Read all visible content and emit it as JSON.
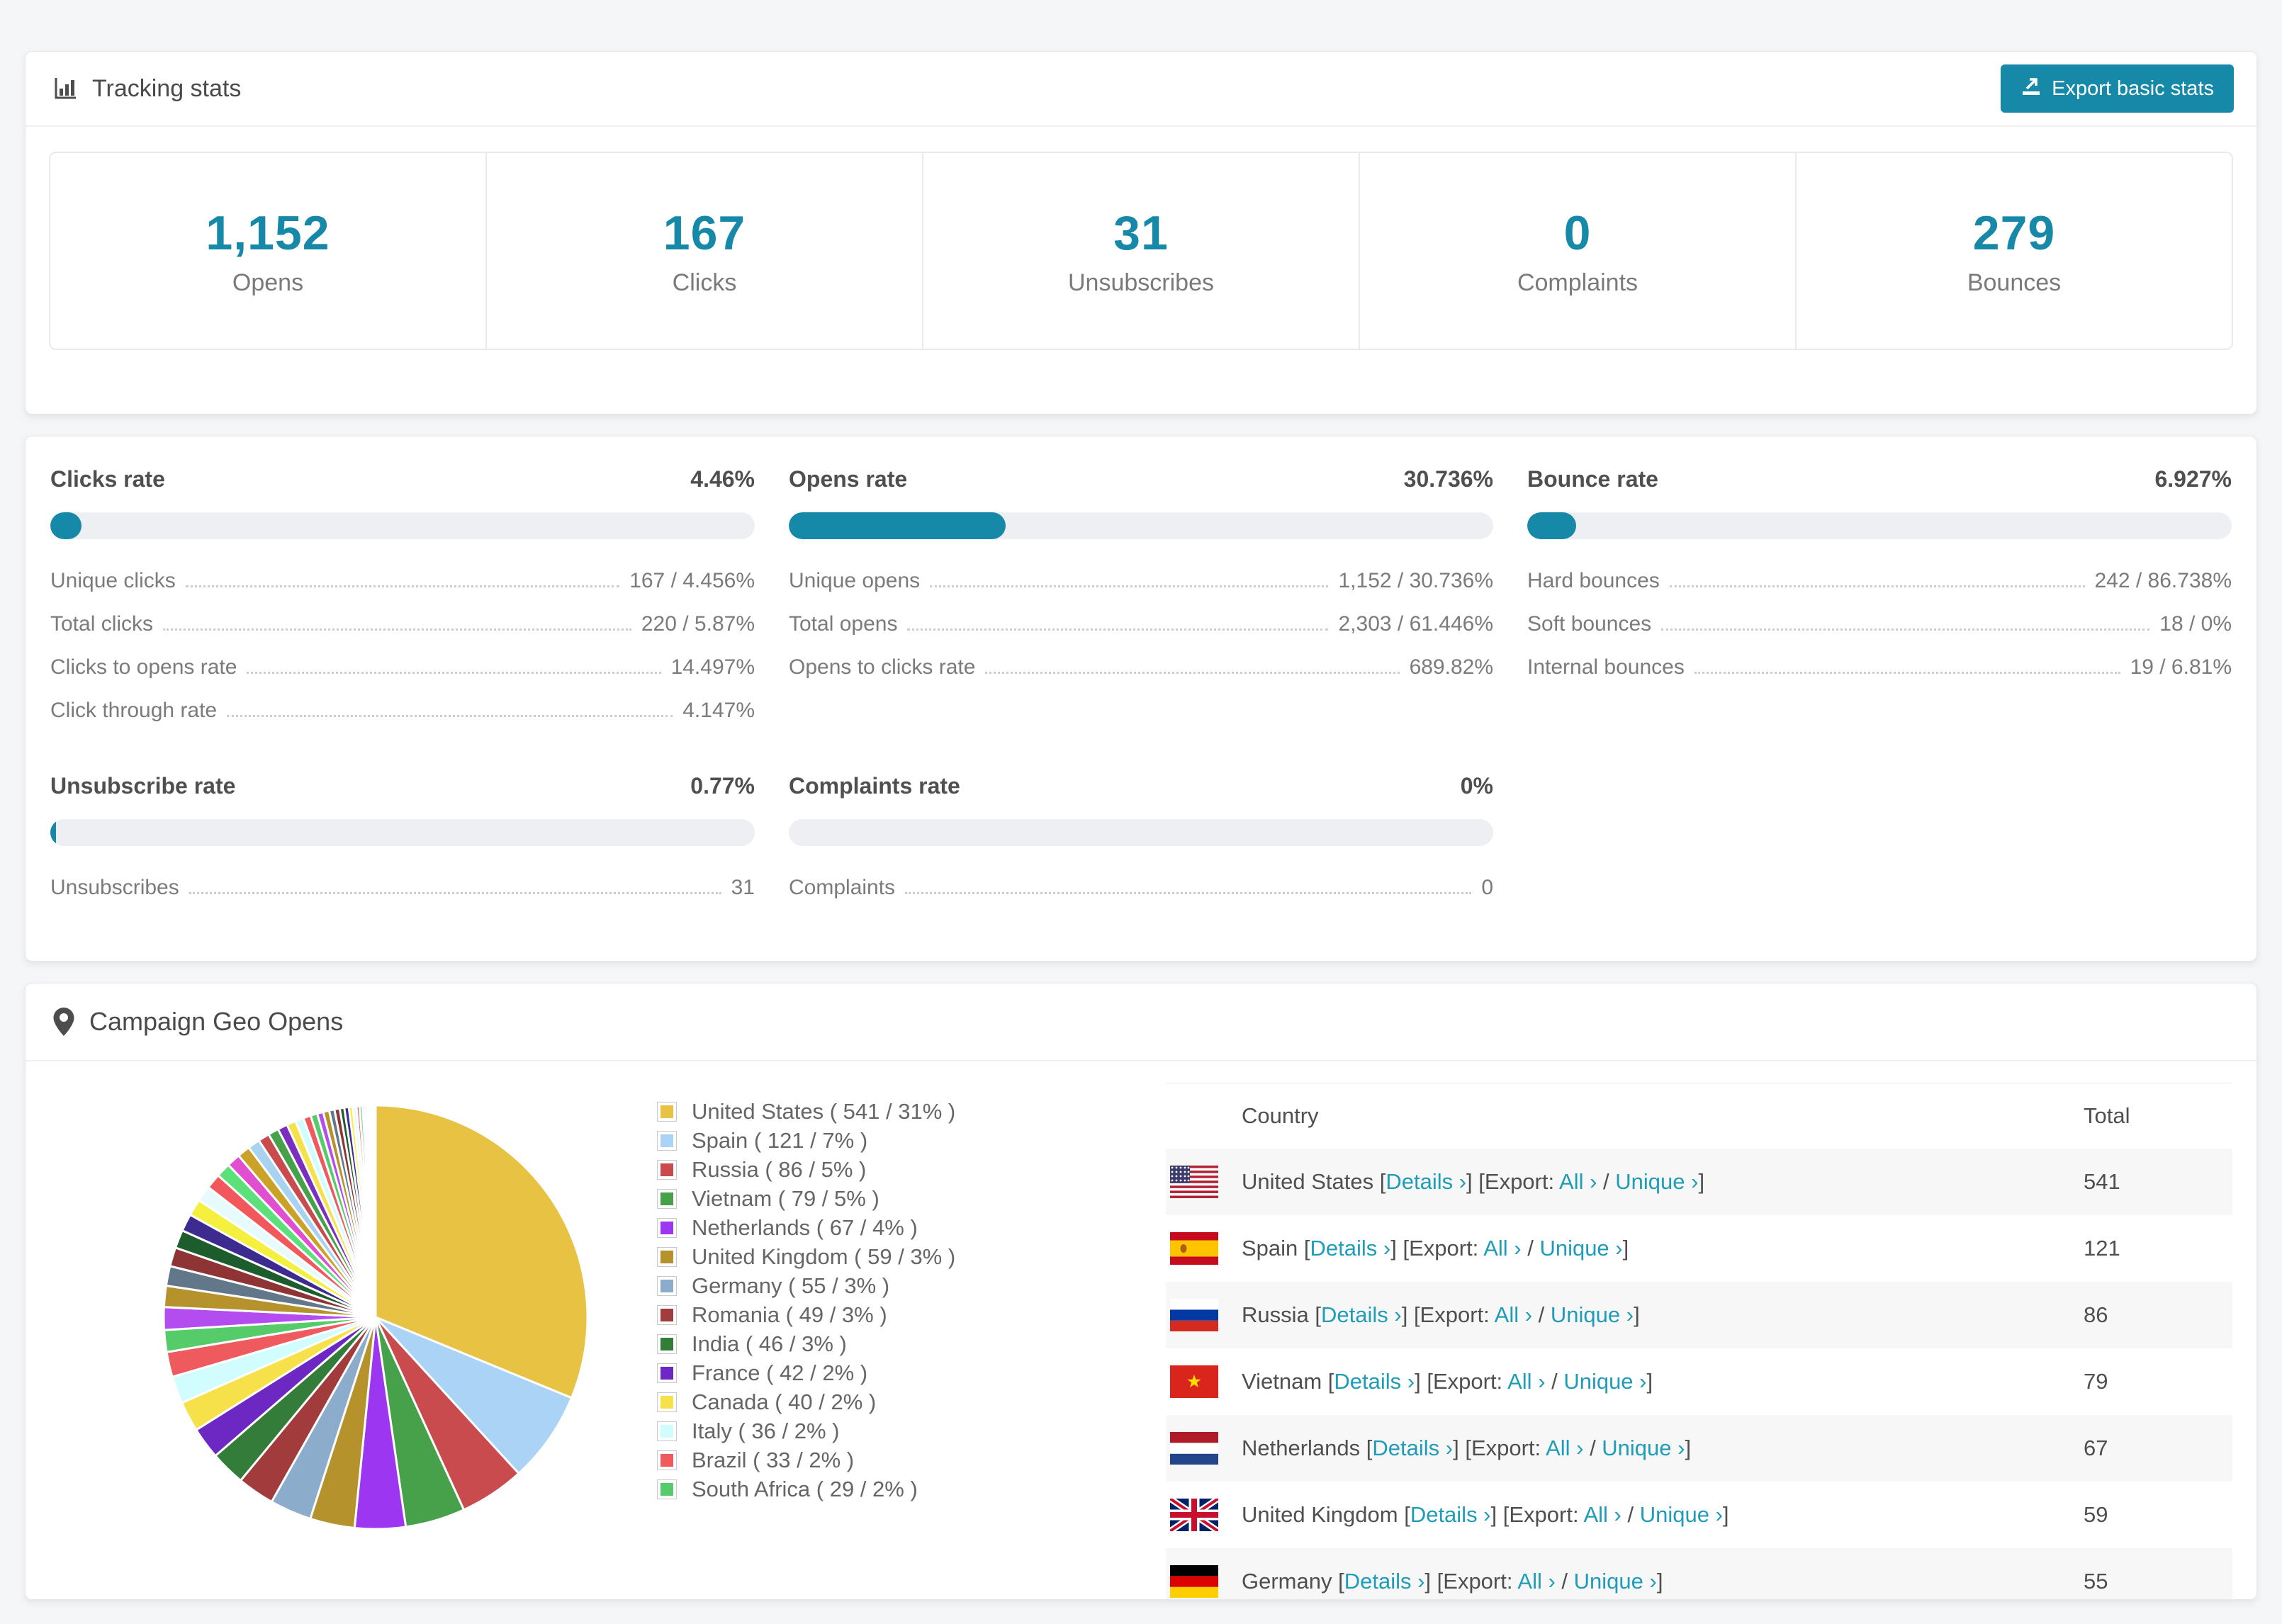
{
  "colors": {
    "accent": "#1689a8",
    "link": "#1f9cb7"
  },
  "tracking_stats": {
    "title": "Tracking stats",
    "export_button": "Export basic stats",
    "stats": [
      {
        "value": "1,152",
        "label": "Opens"
      },
      {
        "value": "167",
        "label": "Clicks"
      },
      {
        "value": "31",
        "label": "Unsubscribes"
      },
      {
        "value": "0",
        "label": "Complaints"
      },
      {
        "value": "279",
        "label": "Bounces"
      }
    ]
  },
  "rates": {
    "top_row": [
      {
        "title": "Clicks rate",
        "value": "4.46%",
        "bar_pct": 4.46,
        "rows": [
          {
            "label": "Unique clicks",
            "value": "167 / 4.456%"
          },
          {
            "label": "Total clicks",
            "value": "220 / 5.87%"
          },
          {
            "label": "Clicks to opens rate",
            "value": "14.497%"
          },
          {
            "label": "Click through rate",
            "value": "4.147%"
          }
        ]
      },
      {
        "title": "Opens rate",
        "value": "30.736%",
        "bar_pct": 30.736,
        "rows": [
          {
            "label": "Unique opens",
            "value": "1,152 / 30.736%"
          },
          {
            "label": "Total opens",
            "value": "2,303 / 61.446%"
          },
          {
            "label": "Opens to clicks rate",
            "value": "689.82%"
          }
        ]
      },
      {
        "title": "Bounce rate",
        "value": "6.927%",
        "bar_pct": 6.927,
        "rows": [
          {
            "label": "Hard bounces",
            "value": "242 / 86.738%"
          },
          {
            "label": "Soft bounces",
            "value": "18 / 0%"
          },
          {
            "label": "Internal bounces",
            "value": "19 / 6.81%"
          }
        ]
      }
    ],
    "bottom_row": [
      {
        "title": "Unsubscribe rate",
        "value": "0.77%",
        "bar_pct": 0.77,
        "rows": [
          {
            "label": "Unsubscribes",
            "value": "31"
          }
        ]
      },
      {
        "title": "Complaints rate",
        "value": "0%",
        "bar_pct": 0,
        "rows": [
          {
            "label": "Complaints",
            "value": "0"
          }
        ]
      }
    ]
  },
  "geo": {
    "title": "Campaign Geo Opens",
    "table": {
      "headers": [
        "Country",
        "Total"
      ],
      "link_labels": {
        "details": "Details ›",
        "export_prefix": "[Export: ",
        "all": "All ›",
        "slash": " / ",
        "unique": "Unique ›"
      },
      "rows": [
        {
          "flag": "us",
          "country": "United States",
          "total": "541"
        },
        {
          "flag": "es",
          "country": "Spain",
          "total": "121"
        },
        {
          "flag": "ru",
          "country": "Russia",
          "total": "86"
        },
        {
          "flag": "vn",
          "country": "Vietnam",
          "total": "79"
        },
        {
          "flag": "nl",
          "country": "Netherlands",
          "total": "67"
        },
        {
          "flag": "gb",
          "country": "United Kingdom",
          "total": "59"
        },
        {
          "flag": "de",
          "country": "Germany",
          "total": "55"
        }
      ]
    }
  },
  "chart_data": {
    "type": "pie",
    "title": "Campaign Geo Opens",
    "legend_position": "right",
    "start_angle_deg": -90,
    "direction": "clockwise",
    "slices": [
      {
        "name": "United States",
        "value": 541,
        "pct": 31,
        "color": "#e8c243"
      },
      {
        "name": "Spain",
        "value": 121,
        "pct": 7,
        "color": "#abd3f5"
      },
      {
        "name": "Russia",
        "value": 86,
        "pct": 5,
        "color": "#ca4b4e"
      },
      {
        "name": "Vietnam",
        "value": 79,
        "pct": 5,
        "color": "#47a14b"
      },
      {
        "name": "Netherlands",
        "value": 67,
        "pct": 4,
        "color": "#9c36f0"
      },
      {
        "name": "United Kingdom",
        "value": 59,
        "pct": 3,
        "color": "#b5922c"
      },
      {
        "name": "Germany",
        "value": 55,
        "pct": 3,
        "color": "#8badcb"
      },
      {
        "name": "Romania",
        "value": 49,
        "pct": 3,
        "color": "#a23c3c"
      },
      {
        "name": "India",
        "value": 46,
        "pct": 3,
        "color": "#337c3a"
      },
      {
        "name": "France",
        "value": 42,
        "pct": 2,
        "color": "#6d28c4"
      },
      {
        "name": "Canada",
        "value": 40,
        "pct": 2,
        "color": "#f7e14a"
      },
      {
        "name": "Italy",
        "value": 36,
        "pct": 2,
        "color": "#d2fdff"
      },
      {
        "name": "Brazil",
        "value": 33,
        "pct": 2,
        "color": "#ef5a5e"
      },
      {
        "name": "South Africa",
        "value": 29,
        "pct": 2,
        "color": "#55cb69"
      }
    ],
    "other_slices": {
      "note": "remaining small unlabeled countries, values estimated from pixels",
      "values": [
        30,
        28,
        26,
        25,
        24,
        23,
        22,
        21,
        20,
        19,
        18,
        17,
        16,
        15,
        14,
        13,
        12,
        11,
        10,
        9,
        8,
        8,
        7,
        7,
        6,
        6,
        5,
        5,
        4,
        4,
        3,
        3,
        2,
        2,
        2,
        1,
        1,
        1,
        1,
        1
      ],
      "palette": [
        "#b44df0",
        "#b5922c",
        "#62788a",
        "#8f3434",
        "#1d5c2c",
        "#3d2b8f",
        "#f5ef3d",
        "#e8fbfc",
        "#f2575c",
        "#5be07a",
        "#e04fd0",
        "#c9a227",
        "#a8d3f0",
        "#c94b4e",
        "#47a14b",
        "#7b2fbe",
        "#f7e14a",
        "#d2fdff",
        "#ef5a5e",
        "#55cb69"
      ]
    }
  }
}
